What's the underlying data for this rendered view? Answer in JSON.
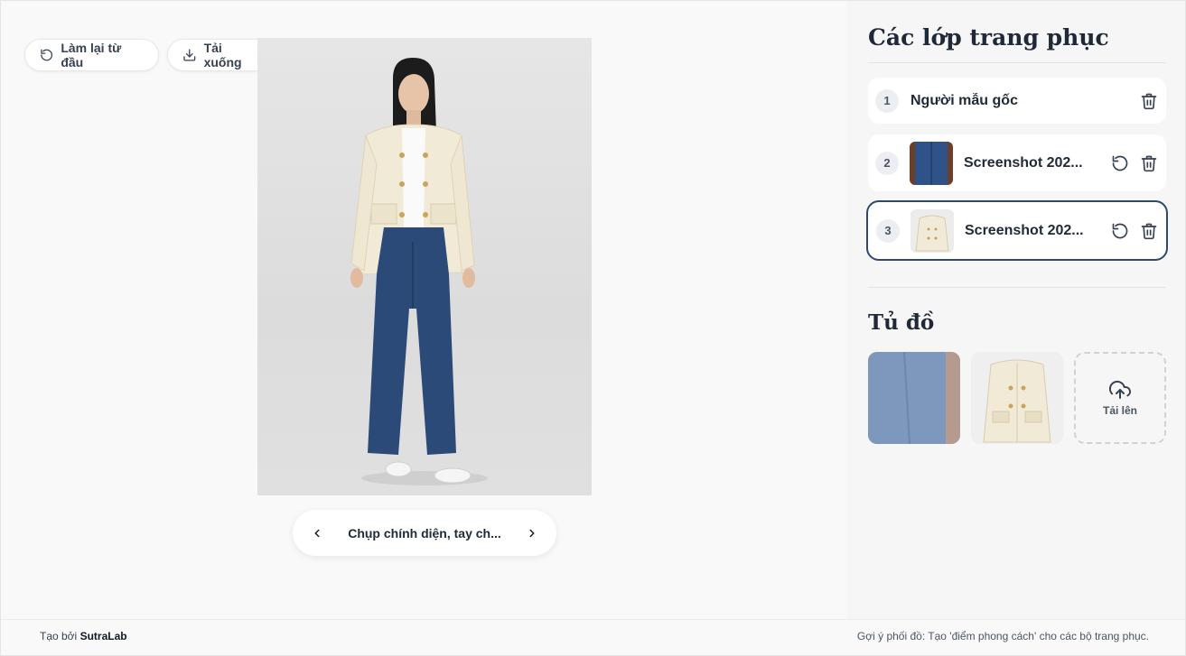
{
  "toolbar": {
    "reset_label": "Làm lại từ đầu",
    "download_label": "Tải xuống"
  },
  "pose_nav": {
    "label": "Chụp chính diện, tay ch..."
  },
  "panel": {
    "title": "Các lớp trang phục",
    "layers": [
      {
        "number": "1",
        "name": "Người mẫu gốc"
      },
      {
        "number": "2",
        "name": "Screenshot 202..."
      },
      {
        "number": "3",
        "name": "Screenshot 202..."
      }
    ],
    "wardrobe_title": "Tủ đồ",
    "upload_label": "Tải lên"
  },
  "footer": {
    "credit_prefix": "Tạo bởi ",
    "credit_brand": "SutraLab",
    "tip": "Gợi ý phối đồ: Tạo 'điểm phong cách' cho các bộ trang phục."
  },
  "colors": {
    "selected_border": "#2d4a6b",
    "denim": "#2c4a78",
    "jacket": "#f1ead7"
  }
}
